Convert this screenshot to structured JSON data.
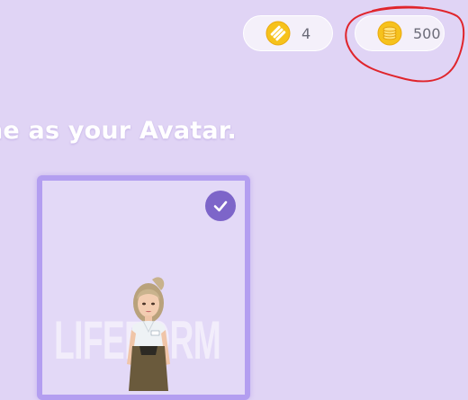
{
  "currency": {
    "tickets": {
      "icon": "ticket-icon",
      "count": "4"
    },
    "coins": {
      "icon": "coin-stack-icon",
      "count": "500"
    }
  },
  "headline": "ne as your Avatar.",
  "avatar_card": {
    "selected": true,
    "watermark": "LIFEFORM",
    "icons": [
      "check-icon",
      "avatar-figure"
    ]
  },
  "annotation": {
    "shape": "freehand-circle",
    "target": "coins",
    "color": "#e0252c"
  },
  "colors": {
    "background": "#e0d4f5",
    "card_border": "#b39ef0",
    "check_badge": "#7d65c9",
    "currency_gold": "#f6c21c"
  }
}
